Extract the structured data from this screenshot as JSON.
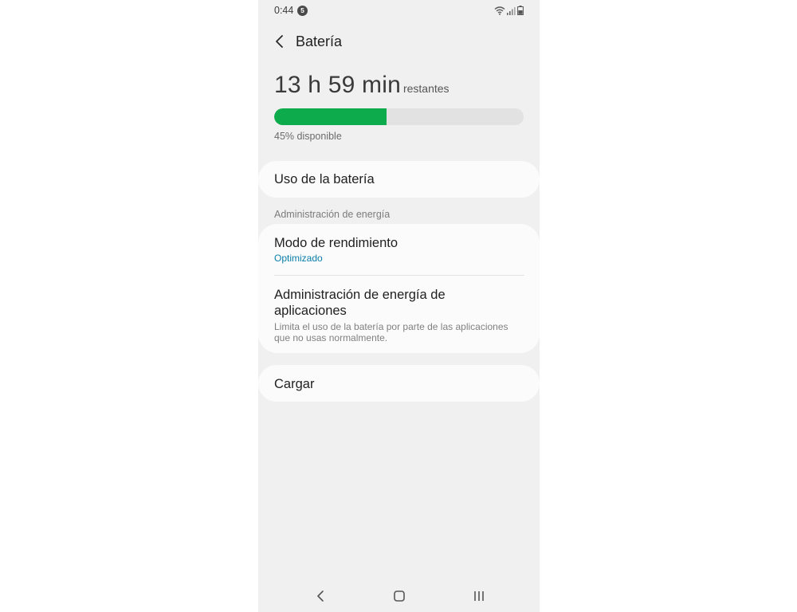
{
  "status_bar": {
    "time": "0:44",
    "notification_count": "5",
    "icons": [
      "wifi-icon",
      "signal-icon",
      "battery-icon"
    ]
  },
  "header": {
    "title": "Batería",
    "back_icon": "back-arrow-icon"
  },
  "battery": {
    "time_remaining": "13 h 59 min",
    "time_suffix": "restantes",
    "percent_text": "45% disponible",
    "level": 0.45,
    "fill_color": "#0dab4c"
  },
  "items": {
    "battery_usage": "Uso de la batería",
    "section_title": "Administración de energía",
    "performance_mode": {
      "title": "Modo de rendimiento",
      "value": "Optimizado"
    },
    "app_power": {
      "title_line1": "Administración de energía de",
      "title_line2": "aplicaciones",
      "desc_line1": "Limita el uso de la batería por parte de las aplicaciones",
      "desc_line2": "que no usas normalmente."
    },
    "charging": "Cargar"
  },
  "nav_bar": {
    "buttons": [
      "back-icon",
      "home-icon",
      "recents-icon"
    ]
  },
  "colors": {
    "accent": "#0a7ea8",
    "background": "#f0f0f0",
    "card": "#fbfbfb"
  }
}
